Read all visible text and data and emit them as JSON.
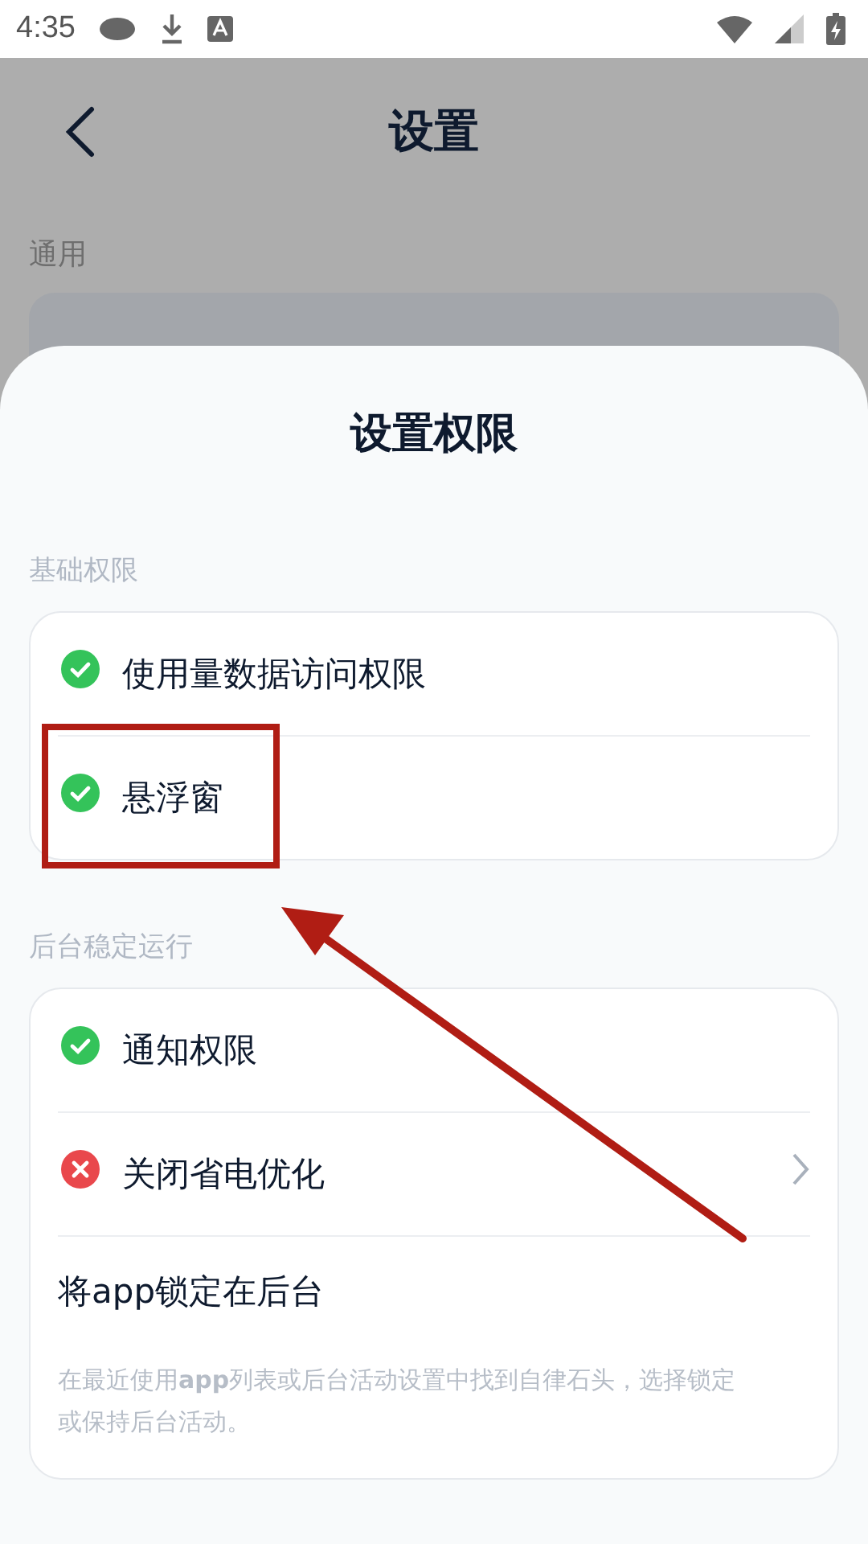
{
  "status_bar": {
    "time": "4:35"
  },
  "background_page": {
    "title": "设置",
    "section": "通用"
  },
  "sheet": {
    "title": "设置权限",
    "sections": [
      {
        "label": "基础权限",
        "items": [
          {
            "kind": "permission",
            "label": "使用量数据访问权限",
            "granted": true,
            "chevron": false,
            "highlighted": false
          },
          {
            "kind": "permission",
            "label": "悬浮窗",
            "granted": true,
            "chevron": false,
            "highlighted": true
          }
        ]
      },
      {
        "label": "后台稳定运行",
        "items": [
          {
            "kind": "permission",
            "label": "通知权限",
            "granted": true,
            "chevron": false,
            "highlighted": false
          },
          {
            "kind": "permission",
            "label": "关闭省电优化",
            "granted": false,
            "chevron": true,
            "highlighted": false
          },
          {
            "kind": "note",
            "label": "将app锁定在后台",
            "description": "在最近使用**app**列表或后台活动设置中找到自律石头，选择锁定或保持后台活动。"
          }
        ]
      }
    ]
  }
}
